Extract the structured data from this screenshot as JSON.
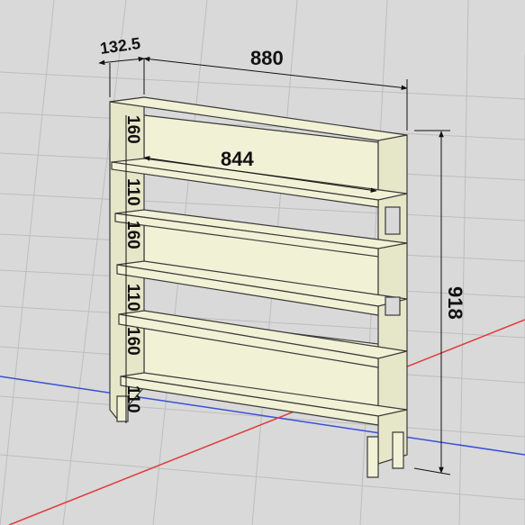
{
  "dimensions": {
    "depth": "132.5",
    "width": "880",
    "inner_width": "844",
    "height": "918"
  },
  "shelf_spacings": [
    "160",
    "110",
    "160",
    "110",
    "160",
    "110"
  ],
  "colors": {
    "background": "#d9d9d9",
    "grid": "#bdbdbd",
    "panel": "#f1f1d6",
    "panel_edge": "#3a3a3a",
    "axis_red": "#e03a3a",
    "axis_blue": "#3a4fd8"
  }
}
